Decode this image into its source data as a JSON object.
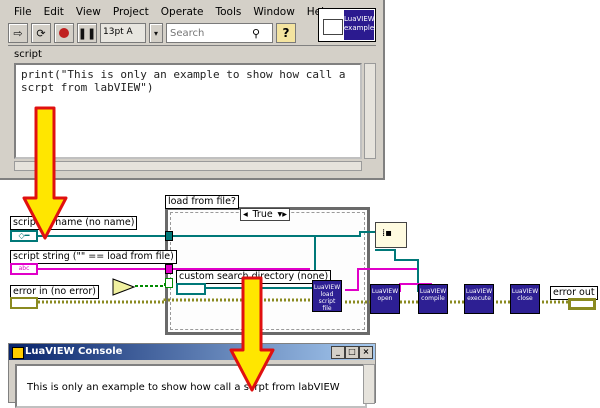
{
  "menu": [
    "File",
    "Edit",
    "View",
    "Project",
    "Operate",
    "Tools",
    "Window",
    "Help"
  ],
  "toolbar": {
    "font_label": "13pt A",
    "search_placeholder": "Search",
    "help_label": "?"
  },
  "vi_icon": {
    "line1": "LuaVIEW",
    "line2": "example"
  },
  "front_panel": {
    "script_label": "script",
    "script_text": "print(\"This is only an example to show how call a scrpt from labVIEW\")"
  },
  "block_diagram": {
    "load_from_file_label": "load from file?",
    "case_selector_value": "True",
    "script_or_name_label": "script or name (no name)",
    "script_string_label": "script string (\"\" == load from file)",
    "error_in_label": "error in (no error)",
    "custom_search_label": "custom search directory (none)",
    "error_out_label": "error out",
    "term_abc": "abc",
    "subvis": [
      {
        "name": "load-script-file",
        "lines": [
          "LuaVIEW",
          "load",
          "script",
          "file"
        ]
      },
      {
        "name": "open",
        "lines": [
          "LuaVIEW",
          "open"
        ]
      },
      {
        "name": "compile",
        "lines": [
          "LuaVIEW",
          "compile"
        ]
      },
      {
        "name": "execute",
        "lines": [
          "LuaVIEW",
          "execute"
        ]
      },
      {
        "name": "close",
        "lines": [
          "LuaVIEW",
          "close"
        ]
      }
    ]
  },
  "console": {
    "title": "LuaVIEW Console",
    "output_text": "This is only an example to show how call a scrpt from labVIEW"
  },
  "colors": {
    "arrow_fill": "#ffe600",
    "arrow_stroke": "#e01010",
    "wire_pink": "#e000c8",
    "wire_teal": "#007878",
    "wire_error": "#a0a020",
    "subvi_bg": "#2d1f93"
  }
}
